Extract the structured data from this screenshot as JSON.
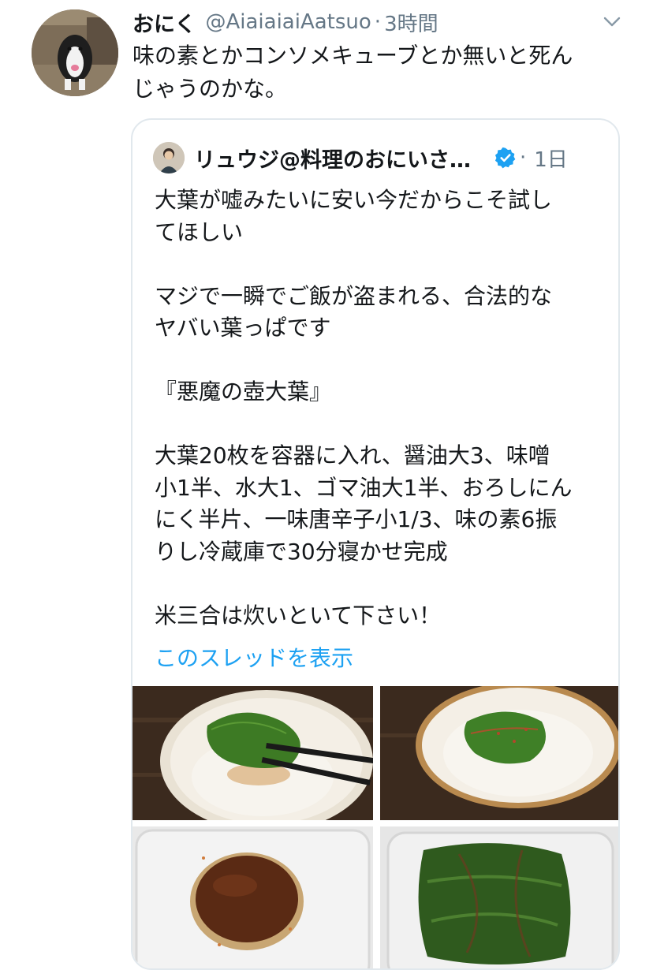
{
  "tweet": {
    "display_name": "おにく",
    "handle": "@AiaiaiaiAatsuo",
    "separator": "·",
    "time": "3時間",
    "text_lines": [
      "味の素とかコンソメキューブとか無いと死ん",
      "じゃうのかな。"
    ]
  },
  "quote": {
    "display_name": "リュウジ@料理のおにいさ…",
    "separator": "·",
    "time": "1日",
    "paragraphs": [
      "大葉が嘘みたいに安い今だからこそ試し\nてほしい",
      "",
      "マジで一瞬でご飯が盗まれる、合法的な\nヤバい葉っぱです",
      "",
      "『悪魔の壺大葉』",
      "",
      "大葉20枚を容器に入れ、醤油大3、味噌\n小1半、水大1、ゴマ油大1半、おろしにん\nにく半片、一味唐辛子小1/3、味の素6振\nりし冷蔵庫で30分寝かせ完成",
      "",
      "米三合は炊いといて下さい！"
    ],
    "thread_link": "このスレッドを表示"
  },
  "colors": {
    "link": "#1da1f2",
    "secondary_text": "#657786",
    "primary_text": "#14171a",
    "border": "#e1e8ed",
    "verified": "#1da1f2"
  },
  "icons": {
    "caret": "chevron-down-icon",
    "verified": "verified-badge-icon"
  }
}
